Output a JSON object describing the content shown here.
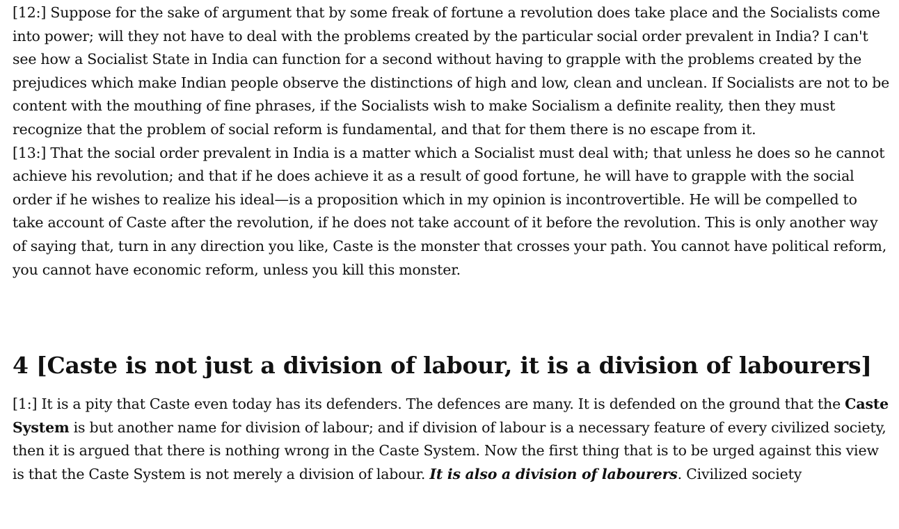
{
  "doc": {
    "para12": {
      "marker": "[12:]",
      "text": "Suppose for the sake of argument that by some freak of fortune a revolution does take place and the Socialists come into power; will they not have to deal with the problems created by the particular social order prevalent in India? I can't see how a Socialist State in India can function for a second without having to grapple with the problems created by the prejudices which make Indian people observe the distinctions of high and low, clean and unclean. If Socialists are not to be content with the mouthing of fine phrases, if the Socialists wish to make Socialism a definite reality, then they must recognize that the problem of social reform is fundamental, and that for them there is no escape from it."
    },
    "para13": {
      "marker": "[13:]",
      "text": "That the social order prevalent in India is a matter which a Socialist must deal with; that unless he does so he cannot achieve his revolution; and that if he does achieve it as a result of good fortune, he will have to grapple with the social order if he wishes to realize his ideal—is a proposition which in my opinion is incontrovertible. He will be compelled to take account of Caste after the revolution, if he does not take account of it before the revolution. This is only another way of saying that, turn in any direction you like, Caste is the monster that crosses your path. You cannot have political reform, you cannot have economic reform, unless you kill this monster."
    },
    "section4": {
      "number": "4",
      "title": "[Caste is not just a division of labour, it is a division of labourers]"
    },
    "para1": {
      "marker": "[1:]",
      "text_a": "It is a pity that Caste even today has its defenders. The defences are many. It is defended on the ground that the",
      "bold_a": "Caste System",
      "text_b": "is but another name for division of labour; and if division of labour is a necessary feature of every civilized society, then it is argued that there is nothing wrong in the Caste System. Now the first thing that is to be urged against this view is that the Caste System is not merely a division of labour.",
      "emphasis": "It is also a division of labourers",
      "text_c": ". Civilized society"
    }
  }
}
